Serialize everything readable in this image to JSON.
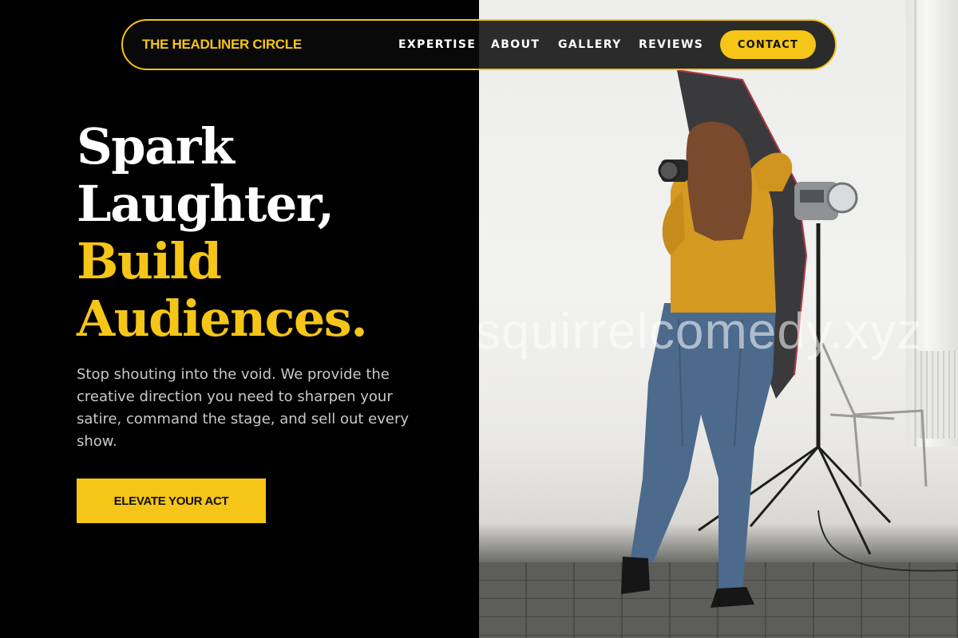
{
  "brand": {
    "name": "THE HEADLINER CIRCLE"
  },
  "nav": {
    "links": [
      {
        "label": "EXPERTISE"
      },
      {
        "label": "ABOUT"
      },
      {
        "label": "GALLERY"
      },
      {
        "label": "REVIEWS"
      }
    ],
    "cta_label": "CONTACT"
  },
  "hero": {
    "headline_line1": "Spark",
    "headline_line2": "Laughter,",
    "headline_line3": "Build",
    "headline_line4": "Audiences.",
    "lede": "Stop shouting into the void. We provide the creative direction you need to sharpen your satire, command the stage, and sell out every show.",
    "cta_label": "ELEVATE YOUR ACT"
  },
  "photo": {
    "watermark": "squirrelcomedy.xyz"
  },
  "colors": {
    "accent": "#f5c518",
    "background": "#000000",
    "text_light": "#ffffff",
    "text_muted": "#c9c9c9"
  }
}
